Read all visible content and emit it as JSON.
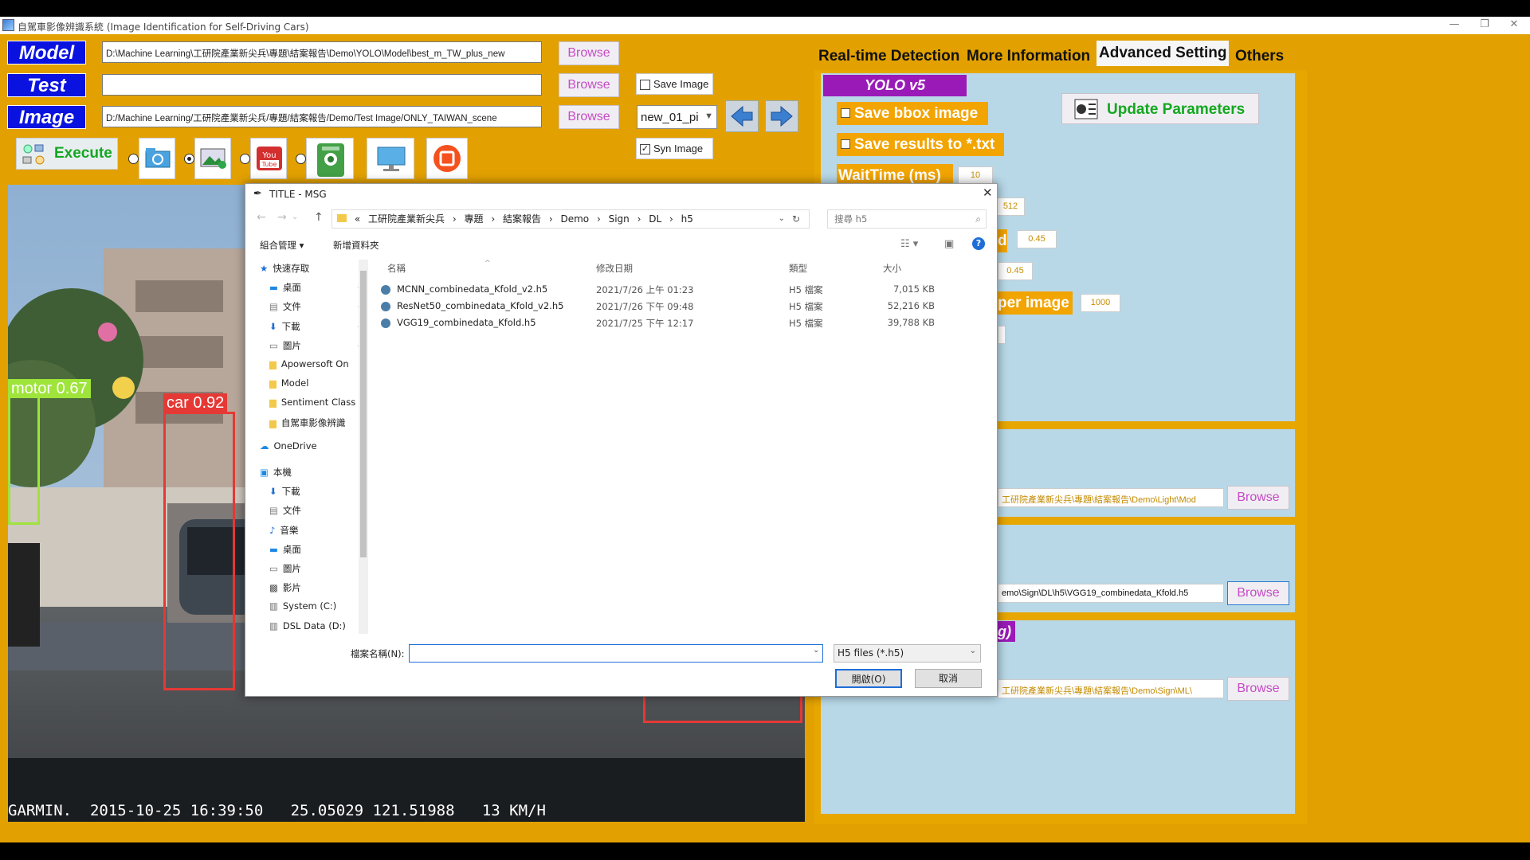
{
  "window": {
    "title": "自駕車影像辨識系統 (Image Identification for Self-Driving Cars)",
    "controls": [
      "—",
      "❐",
      "✕"
    ]
  },
  "left": {
    "model_label": "Model",
    "test_label": "Test",
    "image_label": "Image",
    "model_path": "D:\\Machine Learning\\工研院產業新尖兵\\專題\\結案報告\\Demo\\YOLO\\Model\\best_m_TW_plus_new",
    "test_path": "",
    "image_path": "D:/Machine Learning/工研院產業新尖兵/專題/結案報告/Demo/Test Image/ONLY_TAIWAN_scene",
    "browse": "Browse",
    "save_image": "Save Image",
    "syn_image": "Syn Image",
    "image_select": "new_01_pi",
    "execute": "Execute",
    "source_radio_selected": 1
  },
  "video": {
    "detections": [
      {
        "label": "motor 0.67",
        "color": "#9ee43a"
      },
      {
        "label": "car 0.92",
        "color": "#e53935"
      }
    ],
    "overlay": "GARMIN.  2015-10-25 16:39:50   25.05029 121.51988   13 KM/H"
  },
  "tabs": [
    "Real-time Detection",
    "More Information",
    "Advanced Setting",
    "Others"
  ],
  "active_tab": "Advanced Setting",
  "settings": {
    "yolo_label": "YOLO v5",
    "update_params": "Update Parameters",
    "save_bbox": "Save bbox image",
    "save_results": "Save results to *.txt",
    "wait_time_label": "WaitTime (ms)",
    "wait_time": "10",
    "val_512": "512",
    "val_045a": "0.45",
    "val_045b": "0.45",
    "per_image_label": "per image",
    "per_image_val": "1000",
    "light_path": "工研院產業新尖兵\\專題\\結案報告\\Demo\\Light\\Mod",
    "sign_dl_path": "emo\\Sign\\DL\\h5\\VGG19_combinedata_Kfold.h5",
    "sign_ml_path": "工研院產業新尖兵\\專題\\結案報告\\Demo\\Sign\\ML\\",
    "browse": "Browse",
    "d_fragment": "d",
    "g_fragment": "g)"
  },
  "dialog": {
    "title": "TITLE - MSG",
    "breadcrumb": [
      "«",
      "工研院產業新尖兵",
      "›",
      "專題",
      "›",
      "結案報告",
      "›",
      "Demo",
      "›",
      "Sign",
      "›",
      "DL",
      "›",
      "h5"
    ],
    "search_placeholder": "搜尋 h5",
    "organize": "組合管理 ▾",
    "new_folder": "新增資料夾",
    "tree": [
      {
        "label": "快速存取",
        "icon": "star"
      },
      {
        "label": "桌面",
        "icon": "desktop"
      },
      {
        "label": "文件",
        "icon": "doc"
      },
      {
        "label": "下載",
        "icon": "down"
      },
      {
        "label": "圖片",
        "icon": "pic"
      },
      {
        "label": "Apowersoft On",
        "icon": "folder"
      },
      {
        "label": "Model",
        "icon": "folder"
      },
      {
        "label": "Sentiment Class",
        "icon": "folder"
      },
      {
        "label": "自駕車影像辨識",
        "icon": "folder"
      },
      {
        "label": "OneDrive",
        "icon": "cloud"
      },
      {
        "label": "本機",
        "icon": "pc"
      },
      {
        "label": "下載",
        "icon": "down"
      },
      {
        "label": "文件",
        "icon": "doc"
      },
      {
        "label": "音樂",
        "icon": "music"
      },
      {
        "label": "桌面",
        "icon": "desktop"
      },
      {
        "label": "圖片",
        "icon": "pic"
      },
      {
        "label": "影片",
        "icon": "video"
      },
      {
        "label": "System (C:)",
        "icon": "drive"
      },
      {
        "label": "DSL Data (D:)",
        "icon": "drive"
      }
    ],
    "columns": [
      "名稱",
      "修改日期",
      "類型",
      "大小"
    ],
    "files": [
      {
        "name": "MCNN_combinedata_Kfold_v2.h5",
        "date": "2021/7/26 上午 01:23",
        "type": "H5 檔案",
        "size": "7,015 KB"
      },
      {
        "name": "ResNet50_combinedata_Kfold_v2.h5",
        "date": "2021/7/26 下午 09:48",
        "type": "H5 檔案",
        "size": "52,216 KB"
      },
      {
        "name": "VGG19_combinedata_Kfold.h5",
        "date": "2021/7/25 下午 12:17",
        "type": "H5 檔案",
        "size": "39,788 KB"
      }
    ],
    "filename_label": "檔案名稱(N):",
    "filename_value": "",
    "filter": "H5 files (*.h5)",
    "open": "開啟(O)",
    "cancel": "取消"
  }
}
